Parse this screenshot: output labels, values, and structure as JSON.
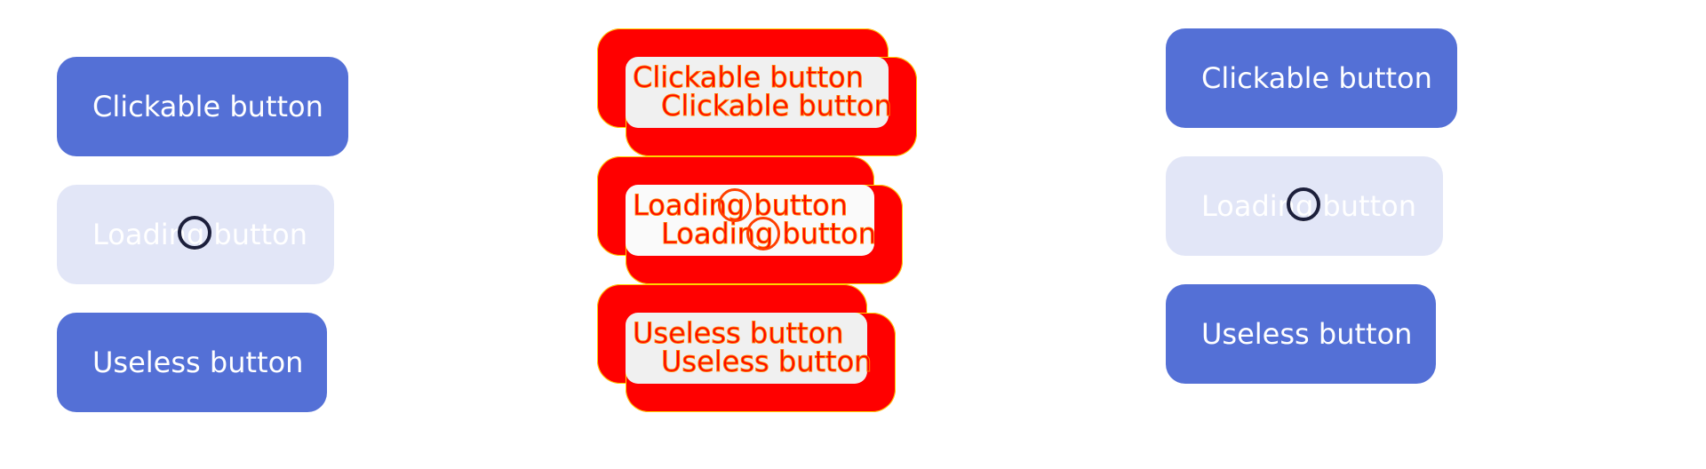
{
  "left": {
    "buttons": [
      {
        "label": "Clickable button",
        "state": "default"
      },
      {
        "label": "Loading button",
        "state": "loading"
      },
      {
        "label": "Useless button",
        "state": "default"
      }
    ]
  },
  "diff": {
    "rows": [
      {
        "label_a": "Clickable button",
        "label_b": "Clickable button"
      },
      {
        "label_a": "Loading button",
        "label_b": "Loading button"
      },
      {
        "label_a": "Useless button",
        "label_b": "Useless button"
      }
    ],
    "colors": {
      "highlight": "#ff0000",
      "outline": "#ffd200"
    }
  },
  "right": {
    "buttons": [
      {
        "label": "Clickable button",
        "state": "default"
      },
      {
        "label": "Loading button",
        "state": "loading"
      },
      {
        "label": "Useless button",
        "state": "default"
      }
    ]
  },
  "colors": {
    "button_primary": "#5470d6",
    "button_loading": "#e2e6f7",
    "spinner": "#1c1f3b",
    "text_on_button": "#ffffff"
  }
}
